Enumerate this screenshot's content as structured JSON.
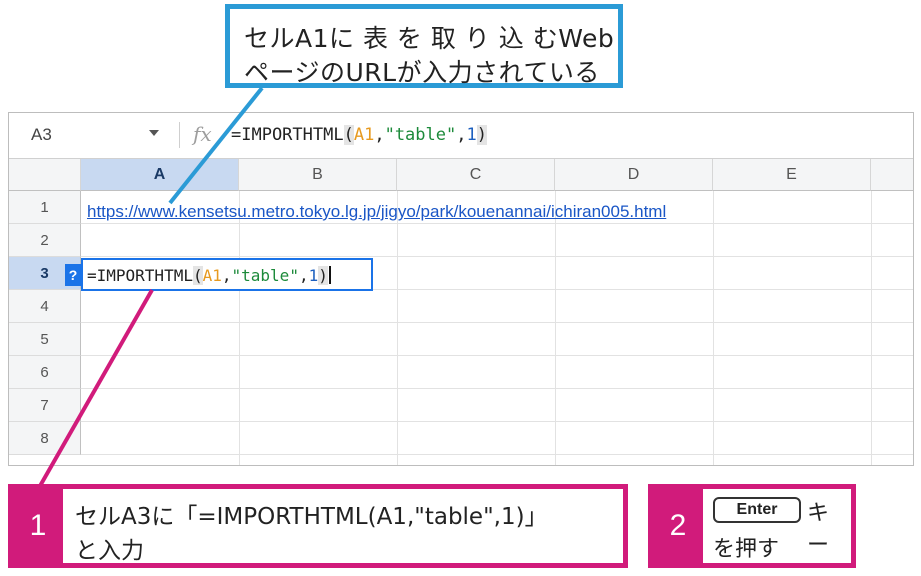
{
  "callout_top": {
    "line1": "セルA1に 表 を 取 り 込 むWeb",
    "line2": "ページのURLが入力されている"
  },
  "formula_bar": {
    "name_box": "A3",
    "fx_label": "fx",
    "formula_parts": {
      "p1": "=IMPORTHTML",
      "open": "(",
      "ref": "A1",
      "comma1": ",",
      "str": "\"table\"",
      "comma2": ",",
      "num": "1",
      "close": ")"
    }
  },
  "columns": [
    "A",
    "B",
    "C",
    "D",
    "E"
  ],
  "rows": [
    "1",
    "2",
    "3",
    "4",
    "5",
    "6",
    "7",
    "8"
  ],
  "cells": {
    "A1": "https://www.kensetsu.metro.tokyo.lg.jp/jigyo/park/kouenannai/ichiran005.html",
    "A3_help": "?"
  },
  "step1": {
    "number": "1",
    "line1": "セルA3に「=IMPORTHTML(A1,\"table\",1)」",
    "line2": "と入力"
  },
  "step2": {
    "number": "2",
    "key": "Enter",
    "key_suffix": "キ ー",
    "line2": "を押す"
  },
  "colors": {
    "blue_callout": "#2b9bd6",
    "magenta_callout": "#d11b7b",
    "selection_blue": "#1a73e8"
  }
}
